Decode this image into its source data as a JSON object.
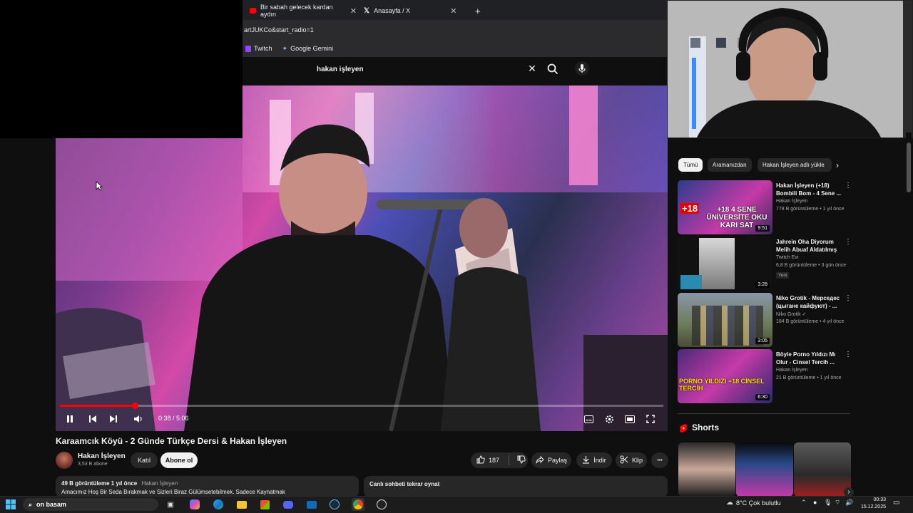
{
  "browser": {
    "tabs": [
      {
        "title": "Bir sabah gelecek kardan aydın",
        "favicon_color": "#ff0000"
      },
      {
        "title": "Anasayfa / X",
        "favicon_color": "#ffffff"
      }
    ],
    "new_tab": "+",
    "address": "artJUKCo&start_radio=1",
    "bookmarks": [
      {
        "label": "Twitch",
        "icon": "twitch-icon"
      },
      {
        "label": "Google Gemini",
        "icon": "gemini-icon"
      }
    ]
  },
  "search": {
    "query": "hakan işleyen",
    "clear_icon": "close-icon",
    "search_icon": "search-icon",
    "mic_icon": "microphone-icon"
  },
  "player": {
    "current_time": "0:38",
    "duration": "5:06",
    "time_display": "0:38 / 5:06",
    "progress_fraction": 0.124,
    "controls": [
      "pause-icon",
      "previous-icon",
      "next-icon",
      "volume-icon",
      "subtitles-icon",
      "settings-icon",
      "miniplayer-icon",
      "fullscreen-icon"
    ]
  },
  "video": {
    "title": "Karaamcık Köyü - 2 Günde Türkçe Dersi & Hakan İşleyen",
    "channel": "Hakan İşleyen",
    "subscribers": "3,53 B abone",
    "join_label": "Katıl",
    "subscribe_label": "Abone ol",
    "likes": "187",
    "share_label": "Paylaş",
    "download_label": "İndir",
    "clip_label": "Klip",
    "more_label": "•••",
    "views_date": "49 B görüntüleme  1 yıl önce",
    "desc_channel": "Hakan İşleyen",
    "description": "Amacımız Hoş Bir Seda Bırakmak ve Sizleri Biraz Gülümsetebilmek. Sadece Kaynatmak",
    "chat_replay": "Canlı sohbeti tekrar oynat"
  },
  "sidebar": {
    "chips": [
      "Tümü",
      "Aramanızdan",
      "Hakan İşleyen adlı yükle"
    ],
    "chip_next_icon": "chevron-right-icon",
    "recommendations": [
      {
        "title": "Hakan İşleyen (+18) Bombili Bom - 4 Sene ...",
        "channel": "Hakan İşleyen",
        "meta": "778 B görüntüleme • 1 yıl önce",
        "duration": "9:51",
        "badge": "",
        "thumb_text": "+18  4 SENE ÜNİVERSİTE OKU KARI SAT"
      },
      {
        "title": "Jahrein Oha Diyorum Melih Abuaf Aldatılmış",
        "channel": "Twitch Evi",
        "meta": "6,8 B görüntüleme • 3 gün önce",
        "duration": "3:28",
        "badge": "Yeni",
        "thumb_text": ""
      },
      {
        "title": "Niko Grotik - Мерседес (цыгане кайфуют) - ...",
        "channel": "Niko Grotik ✓",
        "meta": "184 B görüntüleme • 4 yıl önce",
        "duration": "3:05",
        "badge": "",
        "thumb_text": ""
      },
      {
        "title": "Böyle Porno Yıldızı Mı Olur - Cinsel Tercih ...",
        "channel": "Hakan İşleyen",
        "meta": "21 B görüntüleme • 1 yıl önce",
        "duration": "6:30",
        "badge": "",
        "thumb_text": "PORNO YILDIZI +18 CİNSEL TERCİH"
      }
    ],
    "shorts_title": "Shorts"
  },
  "taskbar": {
    "search_text": "on basam",
    "weather": "8°C  Çok bulutlu",
    "time": "00:33",
    "date": "15.12.2025",
    "apps": [
      "start-icon",
      "task-view-icon",
      "copilot-icon",
      "edge-icon",
      "file-explorer-icon",
      "store-icon",
      "discord-icon",
      "mail-icon",
      "steam-icon",
      "chrome-icon",
      "obs-icon"
    ]
  },
  "colors": {
    "accent_red": "#ff0000",
    "bg": "#0f0f0f",
    "chip_bg": "#272727"
  }
}
